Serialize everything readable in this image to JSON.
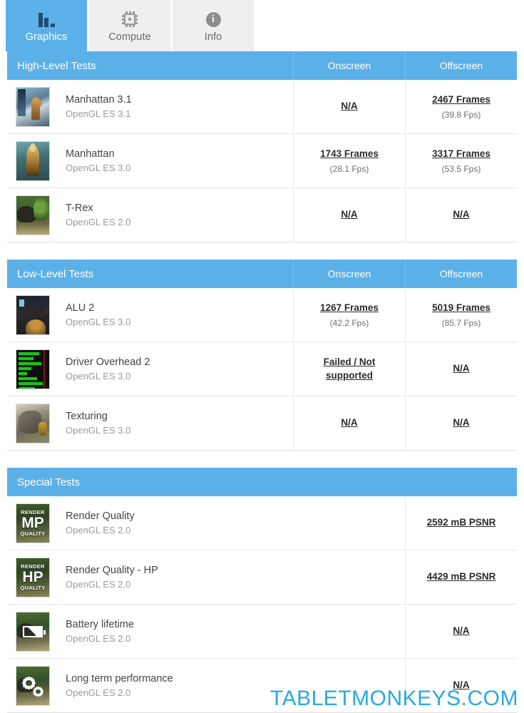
{
  "tabs": [
    {
      "label": "Graphics",
      "icon": "bar-chart-icon",
      "active": true
    },
    {
      "label": "Compute",
      "icon": "cpu-chip-icon",
      "active": false
    },
    {
      "label": "Info",
      "icon": "info-circle-icon",
      "active": false
    }
  ],
  "colors": {
    "accent_blue": "#5bb0e8",
    "watermark": "#29a8e0",
    "tab_inactive_bg": "#efefef",
    "row_border": "#e8e8e8"
  },
  "sections": [
    {
      "title": "High-Level Tests",
      "columns": [
        "Onscreen",
        "Offscreen"
      ],
      "rows": [
        {
          "name": "Manhattan 3.1",
          "api": "OpenGL ES 3.1",
          "thumb": "manhattan-31-thumbnail",
          "onscreen": {
            "main": "N/A",
            "sub": ""
          },
          "offscreen": {
            "main": "2467 Frames",
            "sub": "(39.8 Fps)"
          }
        },
        {
          "name": "Manhattan",
          "api": "OpenGL ES 3.0",
          "thumb": "manhattan-thumbnail",
          "onscreen": {
            "main": "1743 Frames",
            "sub": "(28.1 Fps)"
          },
          "offscreen": {
            "main": "3317 Frames",
            "sub": "(53.5 Fps)"
          }
        },
        {
          "name": "T-Rex",
          "api": "OpenGL ES 2.0",
          "thumb": "t-rex-thumbnail",
          "onscreen": {
            "main": "N/A",
            "sub": ""
          },
          "offscreen": {
            "main": "N/A",
            "sub": ""
          }
        }
      ]
    },
    {
      "title": "Low-Level Tests",
      "columns": [
        "Onscreen",
        "Offscreen"
      ],
      "rows": [
        {
          "name": "ALU 2",
          "api": "OpenGL ES 3.0",
          "thumb": "alu-2-thumbnail",
          "onscreen": {
            "main": "1267 Frames",
            "sub": "(42.2 Fps)"
          },
          "offscreen": {
            "main": "5019 Frames",
            "sub": "(85.7 Fps)"
          }
        },
        {
          "name": "Driver Overhead 2",
          "api": "OpenGL ES 3.0",
          "thumb": "driver-overhead-2-thumbnail",
          "onscreen": {
            "main": "Failed / Not supported",
            "sub": ""
          },
          "offscreen": {
            "main": "N/A",
            "sub": ""
          }
        },
        {
          "name": "Texturing",
          "api": "OpenGL ES 3.0",
          "thumb": "texturing-thumbnail",
          "onscreen": {
            "main": "N/A",
            "sub": ""
          },
          "offscreen": {
            "main": "N/A",
            "sub": ""
          }
        }
      ]
    },
    {
      "title": "Special Tests",
      "columns": [
        ""
      ],
      "rows": [
        {
          "name": "Render Quality",
          "api": "OpenGL ES 2.0",
          "thumb": "render-quality-mp-thumbnail",
          "badge": {
            "top": "RENDER",
            "mid": "MP",
            "bottom": "QUALITY"
          },
          "value": {
            "main": "2592 mB PSNR",
            "sub": ""
          }
        },
        {
          "name": "Render Quality - HP",
          "api": "OpenGL ES 2.0",
          "thumb": "render-quality-hp-thumbnail",
          "badge": {
            "top": "RENDER",
            "mid": "HP",
            "bottom": "QUALITY"
          },
          "value": {
            "main": "4429 mB PSNR",
            "sub": ""
          }
        },
        {
          "name": "Battery lifetime",
          "api": "OpenGL ES 2.0",
          "thumb": "battery-lifetime-thumbnail",
          "value": {
            "main": "N/A",
            "sub": ""
          }
        },
        {
          "name": "Long term performance",
          "api": "OpenGL ES 2.0",
          "thumb": "long-term-performance-thumbnail",
          "value": {
            "main": "N/A",
            "sub": ""
          }
        }
      ]
    }
  ],
  "watermark": "TABLETMONKEYS.COM"
}
